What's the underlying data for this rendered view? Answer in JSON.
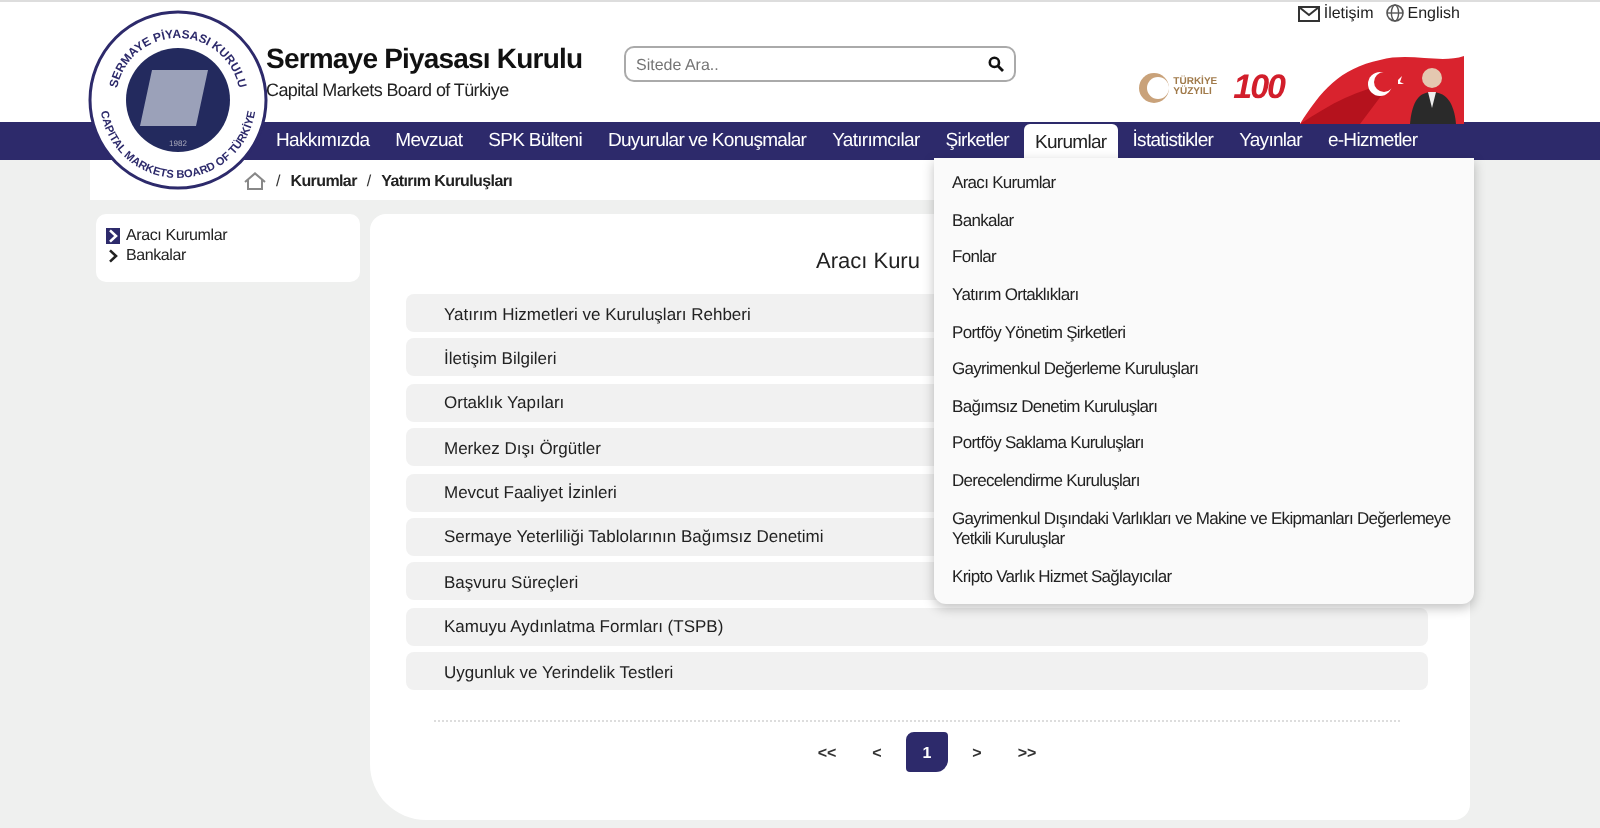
{
  "top_links": [
    "İletişim",
    "English"
  ],
  "logo": {
    "ring_top": "SERMAYE PİYASASI KURULU",
    "ring_bottom": "CAPITAL MARKETS BOARD OF TÜRKİYE",
    "year": "1982"
  },
  "site": {
    "title": "Sermaye Piyasası Kurulu",
    "subtitle": "Capital Markets Board of Türkiye"
  },
  "search": {
    "placeholder": "Sitede Ara.."
  },
  "banner": {
    "badge_line1": "TÜRKİYE",
    "badge_line2": "YÜZYILI",
    "number": "100"
  },
  "nav": [
    {
      "label": "Hakkımızda",
      "selected": false
    },
    {
      "label": "Mevzuat",
      "selected": false
    },
    {
      "label": "SPK Bülteni",
      "selected": false
    },
    {
      "label": "Duyurular ve Konuşmalar",
      "selected": false
    },
    {
      "label": "Yatırımcılar",
      "selected": false
    },
    {
      "label": "Şirketler",
      "selected": false
    },
    {
      "label": "Kurumlar",
      "selected": true
    },
    {
      "label": "İstatistikler",
      "selected": false
    },
    {
      "label": "Yayınlar",
      "selected": false
    },
    {
      "label": "e-Hizmetler",
      "selected": false
    }
  ],
  "dropdown": [
    "Aracı Kurumlar",
    "Bankalar",
    "Fonlar",
    "Yatırım Ortaklıkları",
    "Portföy Yönetim Şirketleri",
    "Gayrimenkul Değerleme Kuruluşları",
    "Bağımsız Denetim Kuruluşları",
    "Portföy Saklama Kuruluşları",
    "Derecelendirme Kuruluşları",
    "Gayrimenkul Dışındaki Varlıkları ve Makine ve Ekipmanları Değerlemeye Yetkili Kuruluşlar",
    "Kripto Varlık Hizmet Sağlayıcılar"
  ],
  "breadcrumb": {
    "separator": "/",
    "items": [
      "Kurumlar",
      "Yatırım Kuruluşları"
    ]
  },
  "sidebar": [
    {
      "label": "Aracı Kurumlar",
      "selected": true
    },
    {
      "label": "Bankalar",
      "selected": false
    }
  ],
  "content": {
    "title": "Aracı Kuru",
    "rows": [
      "Yatırım Hizmetleri ve Kuruluşları Rehberi",
      "İletişim Bilgileri",
      "Ortaklık Yapıları",
      "Merkez Dışı Örgütler",
      "Mevcut Faaliyet İzinleri",
      "Sermaye Yeterliliği Tablolarının Bağımsız Denetimi",
      "Başvuru Süreçleri",
      "Kamuyu Aydınlatma Formları (TSPB)",
      "Uygunluk ve Yerindelik Testleri"
    ]
  },
  "pagination": [
    {
      "label": "<<",
      "selected": false
    },
    {
      "label": "<",
      "selected": false
    },
    {
      "label": "1",
      "selected": true
    },
    {
      "label": ">",
      "selected": false
    },
    {
      "label": ">>",
      "selected": false
    }
  ]
}
